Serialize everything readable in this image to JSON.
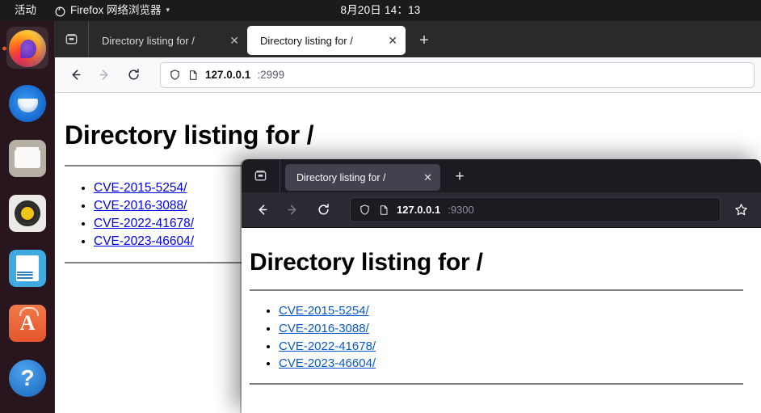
{
  "desktop": {
    "topbar": {
      "activities_label": "活动",
      "app_menu_label": "Firefox 网络浏览器",
      "app_menu_icon": "firefox-icon",
      "app_menu_caret": "▾",
      "clock": "8月20日  14：13"
    },
    "dock": {
      "items": [
        {
          "name": "firefox",
          "label": "Firefox",
          "icon": "firefox-icon",
          "active": true
        },
        {
          "name": "thunderbird",
          "label": "Thunderbird",
          "icon": "thunderbird-icon",
          "active": false
        },
        {
          "name": "files",
          "label": "Files",
          "icon": "folder-icon",
          "active": false
        },
        {
          "name": "rhythmbox",
          "label": "Rhythmbox",
          "icon": "speaker-icon",
          "active": false
        },
        {
          "name": "libreoffice",
          "label": "LibreOffice",
          "icon": "document-icon",
          "active": false
        },
        {
          "name": "ubuntu-software",
          "label": "Ubuntu Software",
          "icon": "software-bag-icon",
          "active": false
        },
        {
          "name": "help",
          "label": "Help",
          "icon": "question-mark-icon",
          "active": false
        }
      ]
    }
  },
  "back_window": {
    "theme": "light",
    "firefox_view_icon": "firefox-view-icon",
    "tabs": [
      {
        "title": "Directory listing for /",
        "active": false,
        "close_glyph": "✕"
      },
      {
        "title": "Directory listing for /",
        "active": true,
        "close_glyph": "✕"
      }
    ],
    "new_tab_glyph": "+",
    "toolbar": {
      "back_glyph": "←",
      "forward_glyph": "→",
      "reload_glyph": "⟳",
      "shield_icon": "shield-icon",
      "page_icon": "page-icon"
    },
    "urlbar": {
      "host": "127.0.0.1",
      "rest": ":2999"
    },
    "page": {
      "heading": "Directory listing for /",
      "links": [
        "CVE-2015-5254/",
        "CVE-2016-3088/",
        "CVE-2022-41678/",
        "CVE-2023-46604/"
      ]
    }
  },
  "front_window": {
    "theme": "dark",
    "firefox_view_icon": "firefox-view-icon",
    "tabs": [
      {
        "title": "Directory listing for /",
        "active": true,
        "close_glyph": "✕"
      }
    ],
    "new_tab_glyph": "+",
    "toolbar": {
      "back_glyph": "←",
      "forward_glyph": "→",
      "reload_glyph": "⟳",
      "shield_icon": "shield-icon",
      "page_icon": "page-icon",
      "bookmark_icon": "star-icon"
    },
    "urlbar": {
      "host": "127.0.0.1",
      "rest": ":9300"
    },
    "page": {
      "heading": "Directory listing for /",
      "links": [
        "CVE-2015-5254/",
        "CVE-2016-3088/",
        "CVE-2022-41678/",
        "CVE-2023-46604/"
      ]
    }
  },
  "colors": {
    "link_back": "#0000ee",
    "link_front": "#0a58d0",
    "ubuntu_orange": "#e95420",
    "topbar_bg": "#1b1b1b",
    "dark_chrome": "#2b2a33"
  }
}
